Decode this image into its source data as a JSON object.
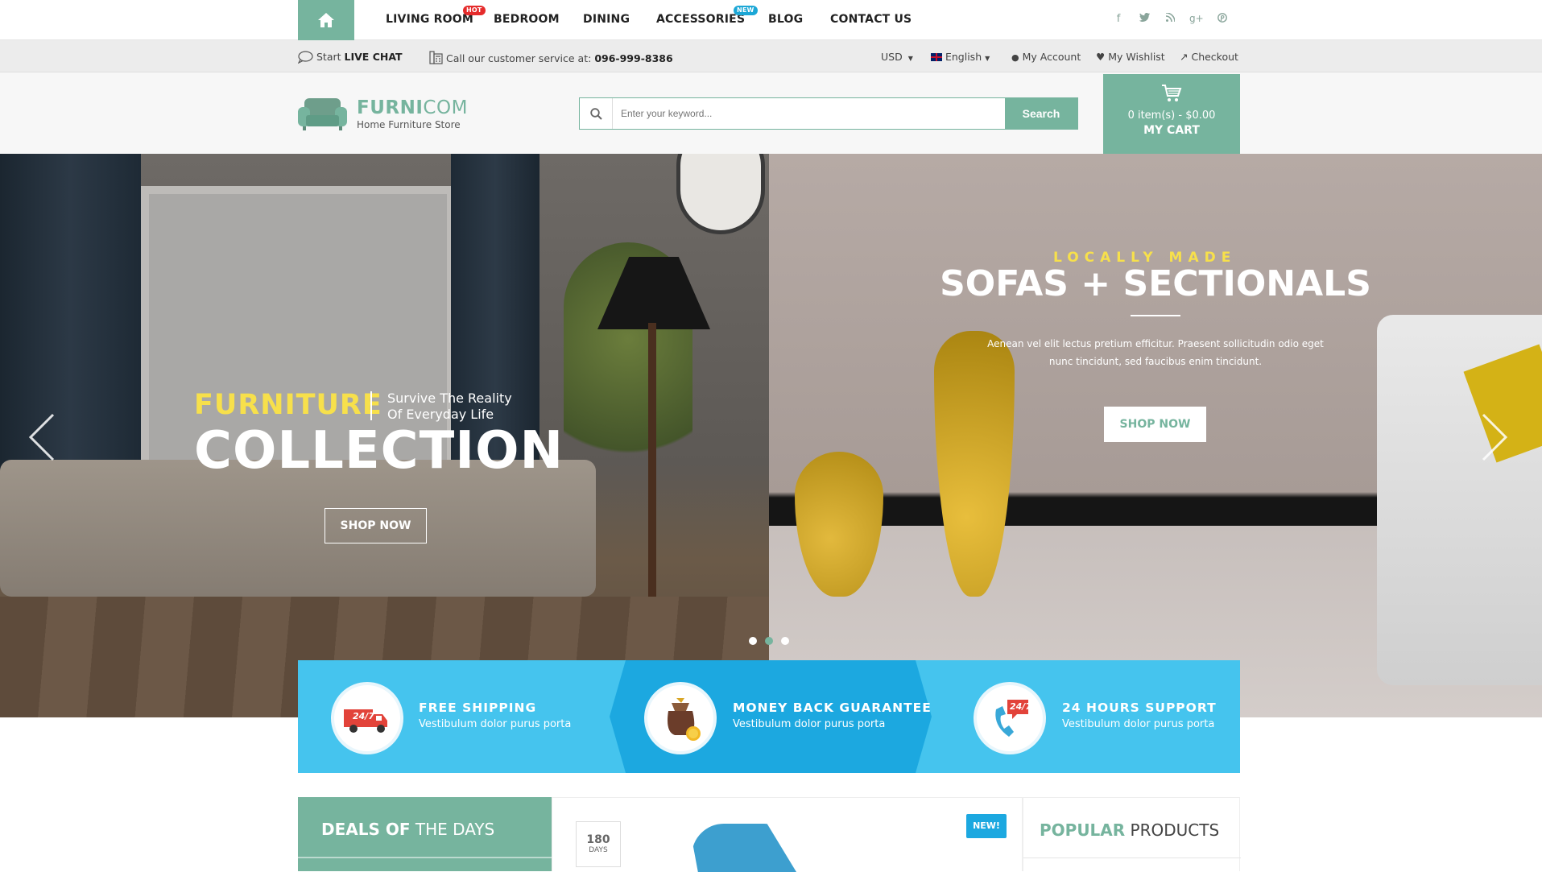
{
  "nav": {
    "items": [
      {
        "label": "LIVING ROOM",
        "badge": "HOT"
      },
      {
        "label": "BEDROOM"
      },
      {
        "label": "DINING"
      },
      {
        "label": "ACCESSORIES",
        "badge": "NEW"
      },
      {
        "label": "BLOG"
      },
      {
        "label": "CONTACT US"
      }
    ],
    "social_icons": [
      "facebook-icon",
      "twitter-icon",
      "rss-icon",
      "google-plus-icon",
      "pinterest-icon"
    ]
  },
  "subbar": {
    "chat_prefix": "Start",
    "chat_bold": "LIVE CHAT",
    "phone_prefix": "Call our customer service at:",
    "phone_number": "096-999-8386",
    "currency": "USD",
    "language": "English",
    "account": "My Account",
    "wishlist": "My Wishlist",
    "checkout": "Checkout"
  },
  "header": {
    "logo_bold": "FURNI",
    "logo_light": "COM",
    "tagline": "Home Furniture Store",
    "search_placeholder": "Enter your keyword...",
    "search_button": "Search",
    "cart_summary": "0 item(s) - $0.00",
    "cart_label": "MY CART"
  },
  "slider": {
    "left": {
      "kicker": "FURNITURE",
      "tagline_line1": "Survive The Reality",
      "tagline_line2": "Of Everyday Life",
      "headline": "COLLECTION",
      "button": "SHOP NOW"
    },
    "right": {
      "kicker": "LOCALLY MADE",
      "headline": "SOFAS + SECTIONALS",
      "body_line1": "Aenean vel elit lectus pretium efficitur. Praesent sollicitudin odio eget",
      "body_line2": "nunc tincidunt, sed faucibus enim tincidunt.",
      "button": "SHOP NOW"
    },
    "dots": 3,
    "active_dot": 2
  },
  "features": [
    {
      "badge": "24/7",
      "title": "FREE SHIPPING",
      "subtitle": "Vestibulum dolor purus porta"
    },
    {
      "title": "MONEY BACK GUARANTEE",
      "subtitle": "Vestibulum dolor purus porta"
    },
    {
      "badge": "24/7",
      "title": "24 HOURS SUPPORT",
      "subtitle": "Vestibulum dolor purus porta"
    }
  ],
  "sections": {
    "deals_bold": "DEALS OF",
    "deals_light": "THE DAYS",
    "countdown_value": "180",
    "countdown_unit": "DAYS",
    "new_badge": "NEW!",
    "popular_bold": "POPULAR",
    "popular_light": "PRODUCTS"
  },
  "colors": {
    "accent": "#76b49e",
    "feature_band": "#45c4ee",
    "feature_center": "#1ca8e0",
    "headline_yellow": "#f7e04b"
  }
}
